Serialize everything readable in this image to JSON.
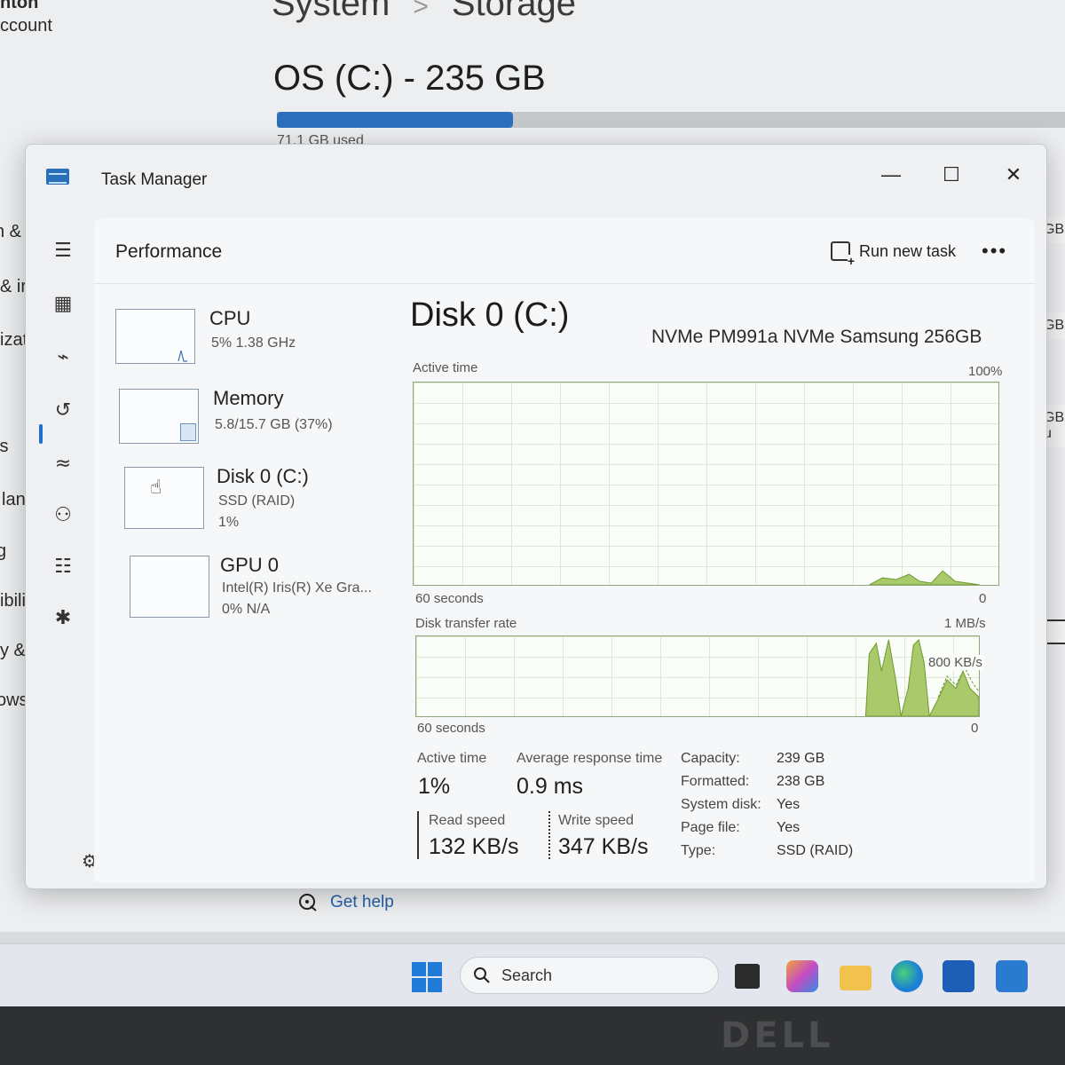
{
  "settings_bg": {
    "nav_fragments": [
      "nton",
      "ccount",
      "n &",
      "& ir",
      "izati",
      "ts",
      "langu",
      "g",
      "ibility",
      "y & sec",
      "ows Up"
    ],
    "breadcrumb": {
      "parent": "System",
      "separator": ">",
      "current": "Storage"
    },
    "drive_title": "OS (C:) - 235 GB",
    "used_label": "71.1 GB used",
    "usage_fraction": 0.3,
    "right_fragments": [
      "GB",
      "GB",
      "GB u"
    ],
    "get_help": "Get help"
  },
  "taskbar": {
    "search_placeholder": "Search",
    "icons": [
      "start-icon",
      "file-manager-icon",
      "copilot-icon",
      "folder-icon",
      "edge-icon",
      "store-icon",
      "app-icon"
    ]
  },
  "brand": "DELL",
  "task_manager": {
    "title": "Task Manager",
    "window_controls": {
      "minimize": "—",
      "maximize": "☐",
      "close": "✕"
    },
    "page_title": "Performance",
    "run_new_task": "Run new task",
    "more": "•••",
    "perf_list": [
      {
        "name": "CPU",
        "sub1": "5% 1.38 GHz",
        "sub2": ""
      },
      {
        "name": "Memory",
        "sub1": "5.8/15.7 GB (37%)",
        "sub2": ""
      },
      {
        "name": "Disk 0 (C:)",
        "sub1": "SSD (RAID)",
        "sub2": "1%"
      },
      {
        "name": "GPU 0",
        "sub1": "Intel(R) Iris(R) Xe Gra...",
        "sub2": "0% N/A"
      }
    ],
    "detail": {
      "title": "Disk 0 (C:)",
      "model": "NVMe PM991a NVMe Samsung 256GB",
      "active_time_graph": {
        "label": "Active time",
        "max": "100%",
        "time": "60 seconds",
        "min": "0"
      },
      "transfer_graph": {
        "label": "Disk transfer rate",
        "max": "1 MB/s",
        "mid": "800 KB/s",
        "time": "60 seconds",
        "min": "0"
      },
      "stats": {
        "active_time_label": "Active time",
        "active_time": "1%",
        "avg_response_label": "Average response time",
        "avg_response": "0.9 ms",
        "read_label": "Read speed",
        "read": "132 KB/s",
        "write_label": "Write speed",
        "write": "347 KB/s"
      },
      "properties": [
        {
          "k": "Capacity:",
          "v": "239 GB"
        },
        {
          "k": "Formatted:",
          "v": "238 GB"
        },
        {
          "k": "System disk:",
          "v": "Yes"
        },
        {
          "k": "Page file:",
          "v": "Yes"
        },
        {
          "k": "Type:",
          "v": "SSD (RAID)"
        }
      ]
    }
  }
}
